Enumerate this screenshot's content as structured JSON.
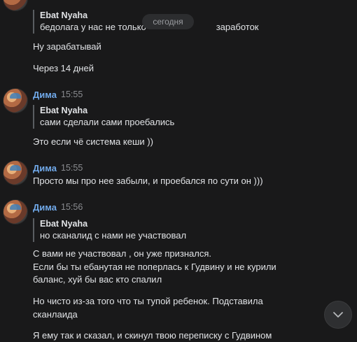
{
  "date_divider": "сегодня",
  "messages": [
    {
      "quote": {
        "author": "Ebat Nyaha",
        "text": "бедолага у нас не только",
        "text_tail": "заработок"
      },
      "lines": [
        "Ну зарабатывай",
        "Через 14 дней"
      ]
    },
    {
      "author": "Дима",
      "time": "15:55",
      "quote": {
        "author": "Ebat Nyaha",
        "text": "сами сделали сами проебались"
      },
      "lines": [
        "Это если чё система кеши ))"
      ]
    },
    {
      "author": "Дима",
      "time": "15:55",
      "lines": [
        "Просто мы про нее забыли, и проебался по сути он )))"
      ]
    },
    {
      "author": "Дима",
      "time": "15:56",
      "quote": {
        "author": "Ebat Nyaha",
        "text": "но сканалид с нами не участвовал"
      },
      "lines": [
        "С вами не участвовал , он уже признался.",
        "Если бы ты ебанутая не поперлась к Гудвину и не курили",
        "баланс, хуй бы вас кто спалил",
        "Но чисто из-за того что ты тупой ребенок. Подставила",
        "сканлаида",
        "Я ему так и сказал, и скинул твою переписку с Гудвином"
      ]
    }
  ]
}
